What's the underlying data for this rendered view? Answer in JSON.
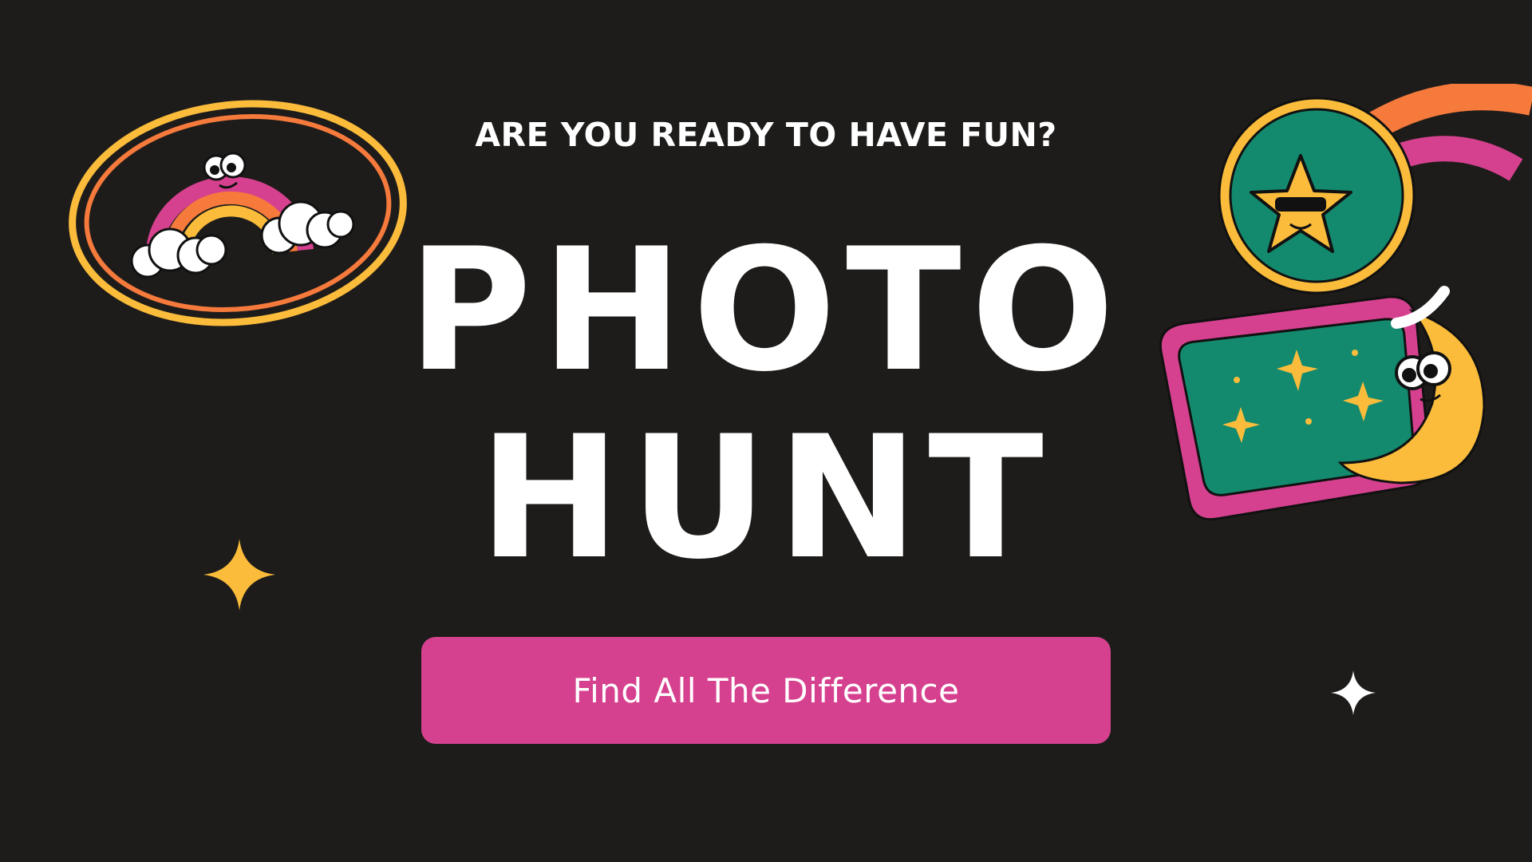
{
  "header": {
    "tagline": "ARE YOU READY TO HAVE FUN?"
  },
  "title": {
    "line1": "PHOTO",
    "line2": "HUNT"
  },
  "cta": {
    "label": "Find All The Difference"
  },
  "decorations": {
    "rainbow_badge_icon": "rainbow-badge-icon",
    "shooting_star_badge_icon": "shooting-star-badge-icon",
    "moon_sticker_icon": "moon-sticker-icon",
    "sparkle_icons": [
      "sparkle-icon-gold",
      "sparkle-icon-white"
    ]
  },
  "colors": {
    "background": "#1e1c1a",
    "button": "#d6418f",
    "gold": "#fbbc3b",
    "orange": "#f57a3c",
    "pink": "#d6418f",
    "teal": "#138a6e",
    "text": "#ffffff"
  }
}
